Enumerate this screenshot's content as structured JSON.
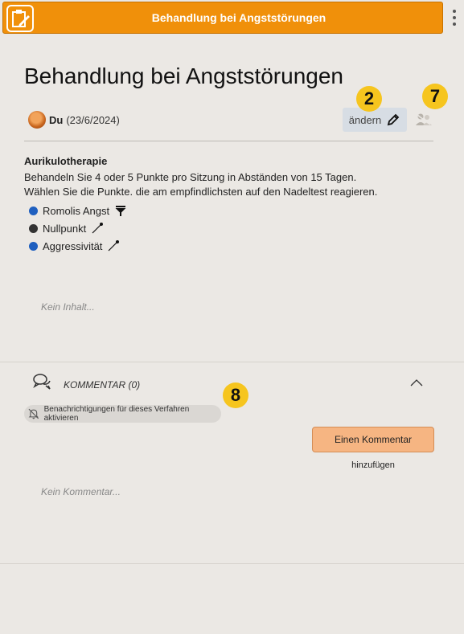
{
  "header": {
    "title": "Behandlung bei Angststörungen",
    "logo_icon": "clipboard-edit-icon",
    "menu_icon": "kebab-menu-icon",
    "accent": "#f0900a"
  },
  "page": {
    "title": "Behandlung bei Angststörungen"
  },
  "author": {
    "name": "Du",
    "date": "(23/6/2024)"
  },
  "toolbar": {
    "edit_label": "ändern",
    "edit_icon": "pencil-icon",
    "share_icon": "users-icon"
  },
  "badges": {
    "edit": "2",
    "share": "7",
    "comments": "8",
    "color": "#f6c51e"
  },
  "content": {
    "section_title": "Aurikulotherapie",
    "line1": "Behandeln Sie 4 oder 5 Punkte pro Sitzung in Abständen von 15 Tagen.",
    "line2": "Wählen Sie die Punkte. die am empfindlichsten auf den Nadeltest reagieren.",
    "points": [
      {
        "label": "Romolis Angst",
        "dot_color": "#1f5fbf",
        "icon": "tack-icon"
      },
      {
        "label": "Nullpunkt",
        "dot_color": "#333333",
        "icon": "needle-icon"
      },
      {
        "label": "Aggressivität",
        "dot_color": "#1f5fbf",
        "icon": "needle-icon"
      }
    ],
    "empty_note": "Kein Inhalt..."
  },
  "comments": {
    "title": "KOMMENTAR (0)",
    "notify_label": "Benachrichtigungen für dieses Verfahren aktivieren",
    "add_label": "Einen Kommentar",
    "add_sub": "hinzufügen",
    "empty": "Kein Kommentar..."
  }
}
